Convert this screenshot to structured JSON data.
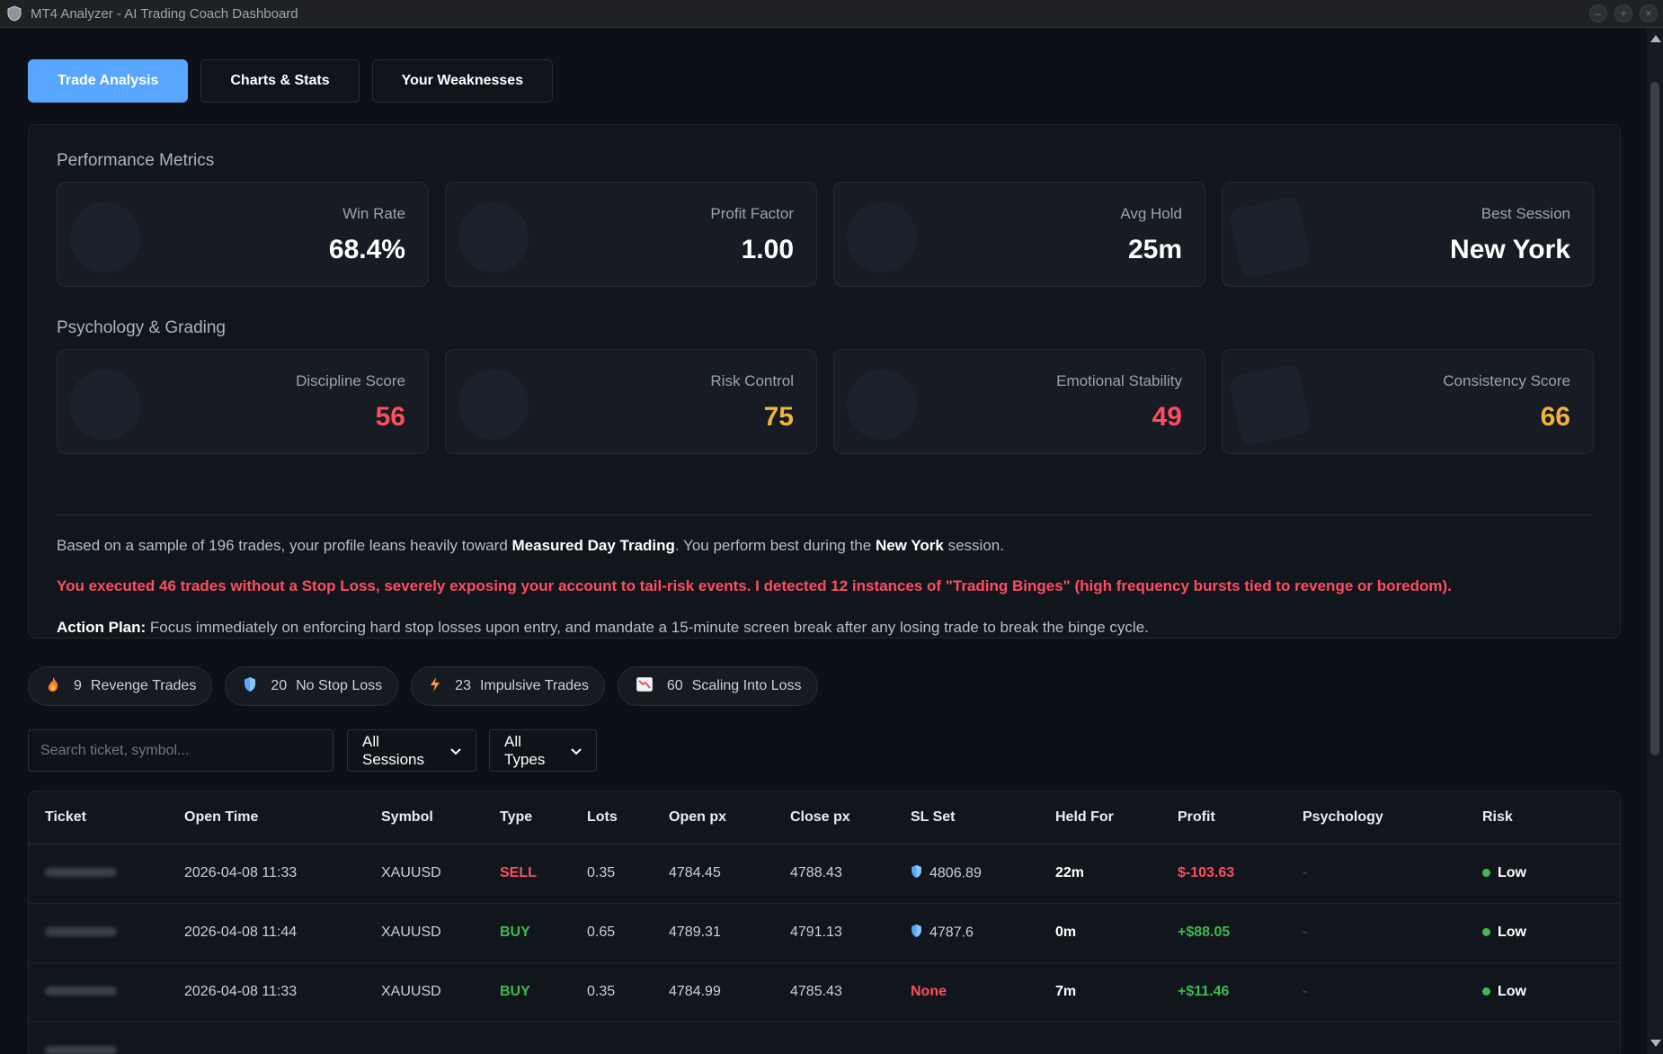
{
  "window": {
    "title": "MT4 Analyzer - AI Trading Coach Dashboard",
    "controls": [
      "–",
      "+",
      "×"
    ]
  },
  "tabs": [
    {
      "label": "Trade Analysis",
      "active": true
    },
    {
      "label": "Charts & Stats",
      "active": false
    },
    {
      "label": "Your Weaknesses",
      "active": false
    }
  ],
  "performance": {
    "title": "Performance Metrics",
    "cards": [
      {
        "label": "Win Rate",
        "value": "68.4%",
        "icon": "trophy-icon"
      },
      {
        "label": "Profit Factor",
        "value": "1.00",
        "icon": "money-bag-icon"
      },
      {
        "label": "Avg Hold",
        "value": "25m",
        "icon": "clock-icon"
      },
      {
        "label": "Best Session",
        "value": "New York",
        "icon": "globe-icon"
      }
    ]
  },
  "psychology": {
    "title": "Psychology & Grading",
    "cards": [
      {
        "label": "Discipline Score",
        "value": "56",
        "color": "#ff4d5e",
        "icon": "brain-icon"
      },
      {
        "label": "Risk Control",
        "value": "75",
        "color": "#f0b43a",
        "icon": "shield-icon"
      },
      {
        "label": "Emotional Stability",
        "value": "49",
        "color": "#ff4d5e",
        "icon": "anchor-icon"
      },
      {
        "label": "Consistency Score",
        "value": "66",
        "color": "#f0b43a",
        "icon": "target-icon"
      }
    ]
  },
  "summary": {
    "p1_a": "Based on a sample of 196 trades, your profile leans heavily toward ",
    "p1_b": "Measured Day Trading",
    "p1_c": ". You perform best during the ",
    "p1_d": "New York",
    "p1_e": " session.",
    "warning": "You executed 46 trades without a Stop Loss, severely exposing your account to tail-risk events. I detected 12 instances of \"Trading Binges\" (high frequency bursts tied to revenge or boredom).",
    "plan_label": "Action Plan:",
    "plan_text": " Focus immediately on enforcing hard stop losses upon entry, and mandate a 15-minute screen break after any losing trade to break the binge cycle."
  },
  "pills": [
    {
      "count": "9",
      "label": "Revenge Trades",
      "icon": "fire-icon"
    },
    {
      "count": "20",
      "label": "No Stop Loss",
      "icon": "shield-icon"
    },
    {
      "count": "23",
      "label": "Impulsive Trades",
      "icon": "lightning-icon"
    },
    {
      "count": "60",
      "label": "Scaling Into Loss",
      "icon": "chart-down-icon"
    }
  ],
  "filters": {
    "search_placeholder": "Search ticket, symbol...",
    "session": "All Sessions",
    "type": "All Types"
  },
  "table": {
    "columns": [
      "Ticket",
      "Open Time",
      "Symbol",
      "Type",
      "Lots",
      "Open px",
      "Close px",
      "SL Set",
      "Held For",
      "Profit",
      "Psychology",
      "Risk"
    ],
    "rows": [
      {
        "open_time": "2026-04-08 11:33",
        "symbol": "XAUUSD",
        "type": "SELL",
        "lots": "0.35",
        "open_px": "4784.45",
        "close_px": "4788.43",
        "sl": "4806.89",
        "held": "22m",
        "profit": "$-103.63",
        "psychology": "-",
        "risk": "Low"
      },
      {
        "open_time": "2026-04-08 11:44",
        "symbol": "XAUUSD",
        "type": "BUY",
        "lots": "0.65",
        "open_px": "4789.31",
        "close_px": "4791.13",
        "sl": "4787.6",
        "held": "0m",
        "profit": "+$88.05",
        "psychology": "-",
        "risk": "Low"
      },
      {
        "open_time": "2026-04-08 11:33",
        "symbol": "XAUUSD",
        "type": "BUY",
        "lots": "0.35",
        "open_px": "4784.99",
        "close_px": "4785.43",
        "sl": "None",
        "held": "7m",
        "profit": "+$11.46",
        "psychology": "-",
        "risk": "Low"
      }
    ]
  }
}
